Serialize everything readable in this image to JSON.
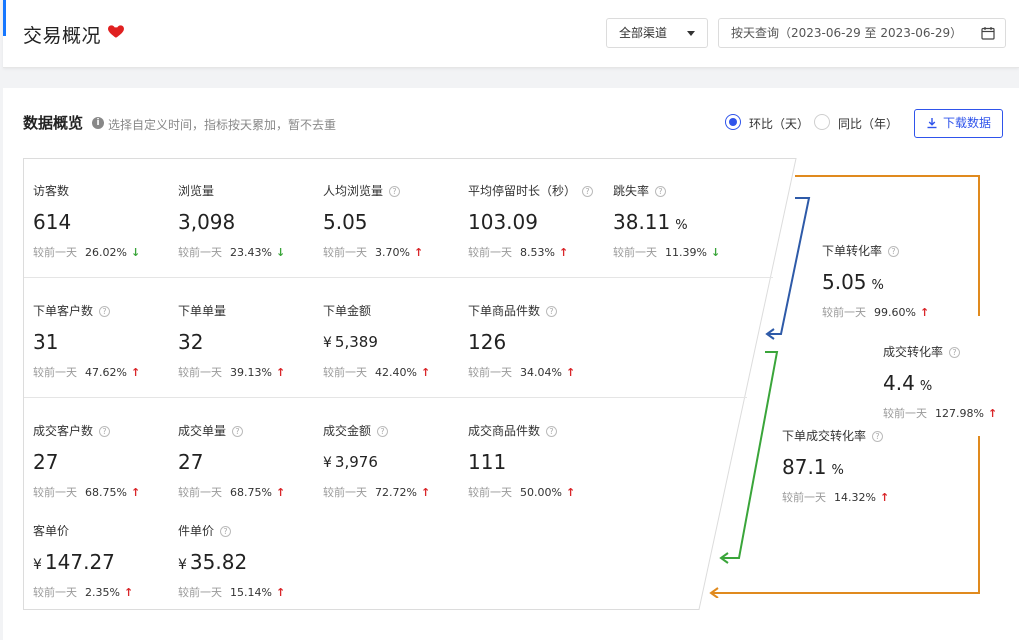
{
  "header": {
    "title": "交易概况",
    "channel_select": "全部渠道",
    "date_query": "按天查询（2023-06-29 至 2023-06-29）"
  },
  "overview": {
    "title": "数据概览",
    "hint": "选择自定义时间，指标按天累加，暂不去重",
    "radio_mom": "环比（天）",
    "radio_yoy": "同比（年）",
    "download_label": "下载数据"
  },
  "compare_label": "较前一天",
  "metrics": {
    "visitors": {
      "label": "访客数",
      "value": "614",
      "pct": "26.02%",
      "trend": "down"
    },
    "pageviews": {
      "label": "浏览量",
      "value": "3,098",
      "pct": "23.43%",
      "trend": "down"
    },
    "avg_pv": {
      "label": "人均浏览量",
      "value": "5.05",
      "pct": "3.70%",
      "trend": "up"
    },
    "avg_stay": {
      "label": "平均停留时长（秒）",
      "value": "103.09",
      "pct": "8.53%",
      "trend": "up"
    },
    "bounce": {
      "label": "跳失率",
      "value": "38.11",
      "unit": "%",
      "pct": "11.39%",
      "trend": "down"
    },
    "order_customers": {
      "label": "下单客户数",
      "value": "31",
      "pct": "47.62%",
      "trend": "up"
    },
    "order_count": {
      "label": "下单单量",
      "value": "32",
      "pct": "39.13%",
      "trend": "up"
    },
    "order_amount": {
      "label": "下单金额",
      "currency": "¥",
      "value": "5,389",
      "pct": "42.40%",
      "trend": "up"
    },
    "order_items": {
      "label": "下单商品件数",
      "value": "126",
      "pct": "34.04%",
      "trend": "up"
    },
    "deal_customers": {
      "label": "成交客户数",
      "value": "27",
      "pct": "68.75%",
      "trend": "up"
    },
    "deal_count": {
      "label": "成交单量",
      "value": "27",
      "pct": "68.75%",
      "trend": "up"
    },
    "deal_amount": {
      "label": "成交金额",
      "currency": "¥",
      "value": "3,976",
      "pct": "72.72%",
      "trend": "up"
    },
    "deal_items": {
      "label": "成交商品件数",
      "value": "111",
      "pct": "50.00%",
      "trend": "up"
    },
    "per_customer": {
      "label": "客单价",
      "currency": "¥",
      "value": "147.27",
      "pct": "2.35%",
      "trend": "up"
    },
    "per_item": {
      "label": "件单价",
      "currency": "¥",
      "value": "35.82",
      "pct": "15.14%",
      "trend": "up"
    }
  },
  "conversions": {
    "order_rate": {
      "label": "下单转化率",
      "value": "5.05",
      "unit": "%",
      "pct": "99.60%",
      "trend": "up"
    },
    "deal_rate": {
      "label": "成交转化率",
      "value": "4.4",
      "unit": "%",
      "pct": "127.98%",
      "trend": "up"
    },
    "order_deal_rate": {
      "label": "下单成交转化率",
      "value": "87.1",
      "unit": "%",
      "pct": "14.32%",
      "trend": "up"
    }
  },
  "colors": {
    "accent": "#2f54eb",
    "up": "#d9262a",
    "down": "#3aa53a",
    "flow_blue": "#2e5aa8",
    "flow_green": "#3aa53a",
    "flow_orange": "#e08a1e"
  }
}
